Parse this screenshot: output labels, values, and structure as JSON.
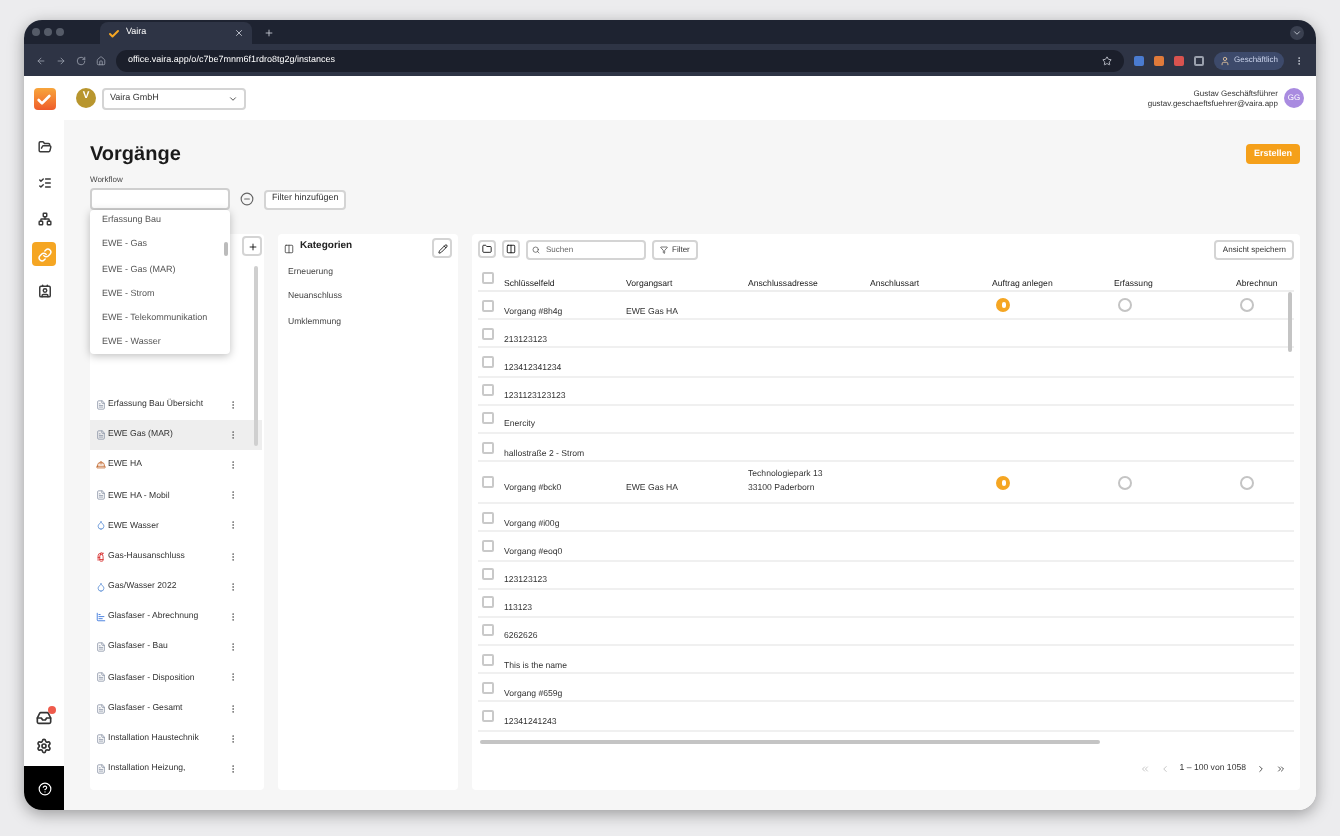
{
  "browser": {
    "tab_title": "Vaira",
    "url": "office.vaira.app/o/c7be7mnm6f1rdro8tg2g/instances",
    "profile": "Geschäftlich"
  },
  "header": {
    "company_initial": "V",
    "company": "Vaira GmbH",
    "user_name": "Gustav Geschäftsführer",
    "user_email": "gustav.geschaeftsfuehrer@vaira.app",
    "user_initials": "GG"
  },
  "rail": {
    "items": [
      {
        "kind": "folder",
        "selected": false
      },
      {
        "kind": "tasks",
        "selected": false
      },
      {
        "kind": "network",
        "selected": false
      },
      {
        "kind": "link",
        "selected": true
      },
      {
        "kind": "contact",
        "selected": false
      }
    ],
    "has_notification": true
  },
  "page": {
    "title": "Vorgänge",
    "create_button": "Erstellen",
    "workflow_label": "Workflow",
    "filter_button": "Filter hinzufügen"
  },
  "workflow_dropdown": [
    "Erfassung Bau",
    "EWE - Gas",
    "EWE - Gas (MAR)",
    "EWE - Strom",
    "EWE - Telekommunikation",
    "EWE - Wasser"
  ],
  "workflows": {
    "items": [
      {
        "label": "Erfassung Bau Übersicht",
        "kind": "form",
        "selected": false
      },
      {
        "label": "EWE Gas (MAR)",
        "kind": "form",
        "selected": true
      },
      {
        "label": "EWE HA",
        "kind": "worker",
        "selected": false
      },
      {
        "label": "EWE HA - Mobil",
        "kind": "form",
        "selected": false
      },
      {
        "label": "EWE Wasser",
        "kind": "water",
        "selected": false
      },
      {
        "label": "Gas-Hausanschluss",
        "kind": "hydrant",
        "selected": false
      },
      {
        "label": "Gas/Wasser 2022",
        "kind": "water",
        "selected": false
      },
      {
        "label": "Glasfaser - Abrechnung",
        "kind": "chart",
        "selected": false
      },
      {
        "label": "Glasfaser - Bau",
        "kind": "form",
        "selected": false
      },
      {
        "label": "Glasfaser - Disposition",
        "kind": "form",
        "selected": false
      },
      {
        "label": "Glasfaser - Gesamt",
        "kind": "form",
        "selected": false
      },
      {
        "label": "Installation Haustechnik",
        "kind": "form",
        "selected": false
      },
      {
        "label": "Installation Heizung,",
        "kind": "form",
        "selected": false
      }
    ]
  },
  "categories": {
    "title": "Kategorien",
    "items": [
      "Erneuerung",
      "Neuanschluss",
      "Umklemmung"
    ]
  },
  "table": {
    "search_placeholder": "Suchen",
    "filter_button": "Filter",
    "save_view_button": "Ansicht speichern",
    "select_all_checked": false,
    "columns": [
      "Schlüsselfeld",
      "Vorgangsart",
      "Anschlussadresse",
      "Anschlussart",
      "Auftrag anlegen",
      "Erfassung",
      "Abrechnun"
    ],
    "rows": [
      {
        "key": "Vorgang #8h4g",
        "type": "EWE Gas HA",
        "checked": false,
        "statuses": [
          {
            "kind": "in_progress"
          },
          {
            "kind": "open"
          },
          {
            "kind": "open"
          }
        ]
      },
      {
        "key": "213123123",
        "checked": false
      },
      {
        "key": "123412341234",
        "checked": false
      },
      {
        "key": "1231123123123",
        "checked": false
      },
      {
        "key": "Enercity",
        "checked": false
      },
      {
        "key": "hallostraße 2 - Strom",
        "checked": false
      },
      {
        "key": "Vorgang #bck0",
        "type": "EWE Gas HA",
        "address": [
          "Technologiepark 13",
          "33100 Paderborn"
        ],
        "checked": false,
        "statuses": [
          {
            "kind": "in_progress"
          },
          {
            "kind": "open"
          },
          {
            "kind": "open"
          }
        ]
      },
      {
        "key": "Vorgang #i00g",
        "checked": false
      },
      {
        "key": "Vorgang #eoq0",
        "checked": false
      },
      {
        "key": "123123123",
        "checked": false
      },
      {
        "key": "113123",
        "checked": false
      },
      {
        "key": "6262626",
        "checked": false
      },
      {
        "key": "This is the name",
        "checked": false
      },
      {
        "key": "Vorgang #659g",
        "checked": false
      },
      {
        "key": "12341241243",
        "checked": false
      }
    ],
    "pagination": "1 – 100 von 1058"
  }
}
